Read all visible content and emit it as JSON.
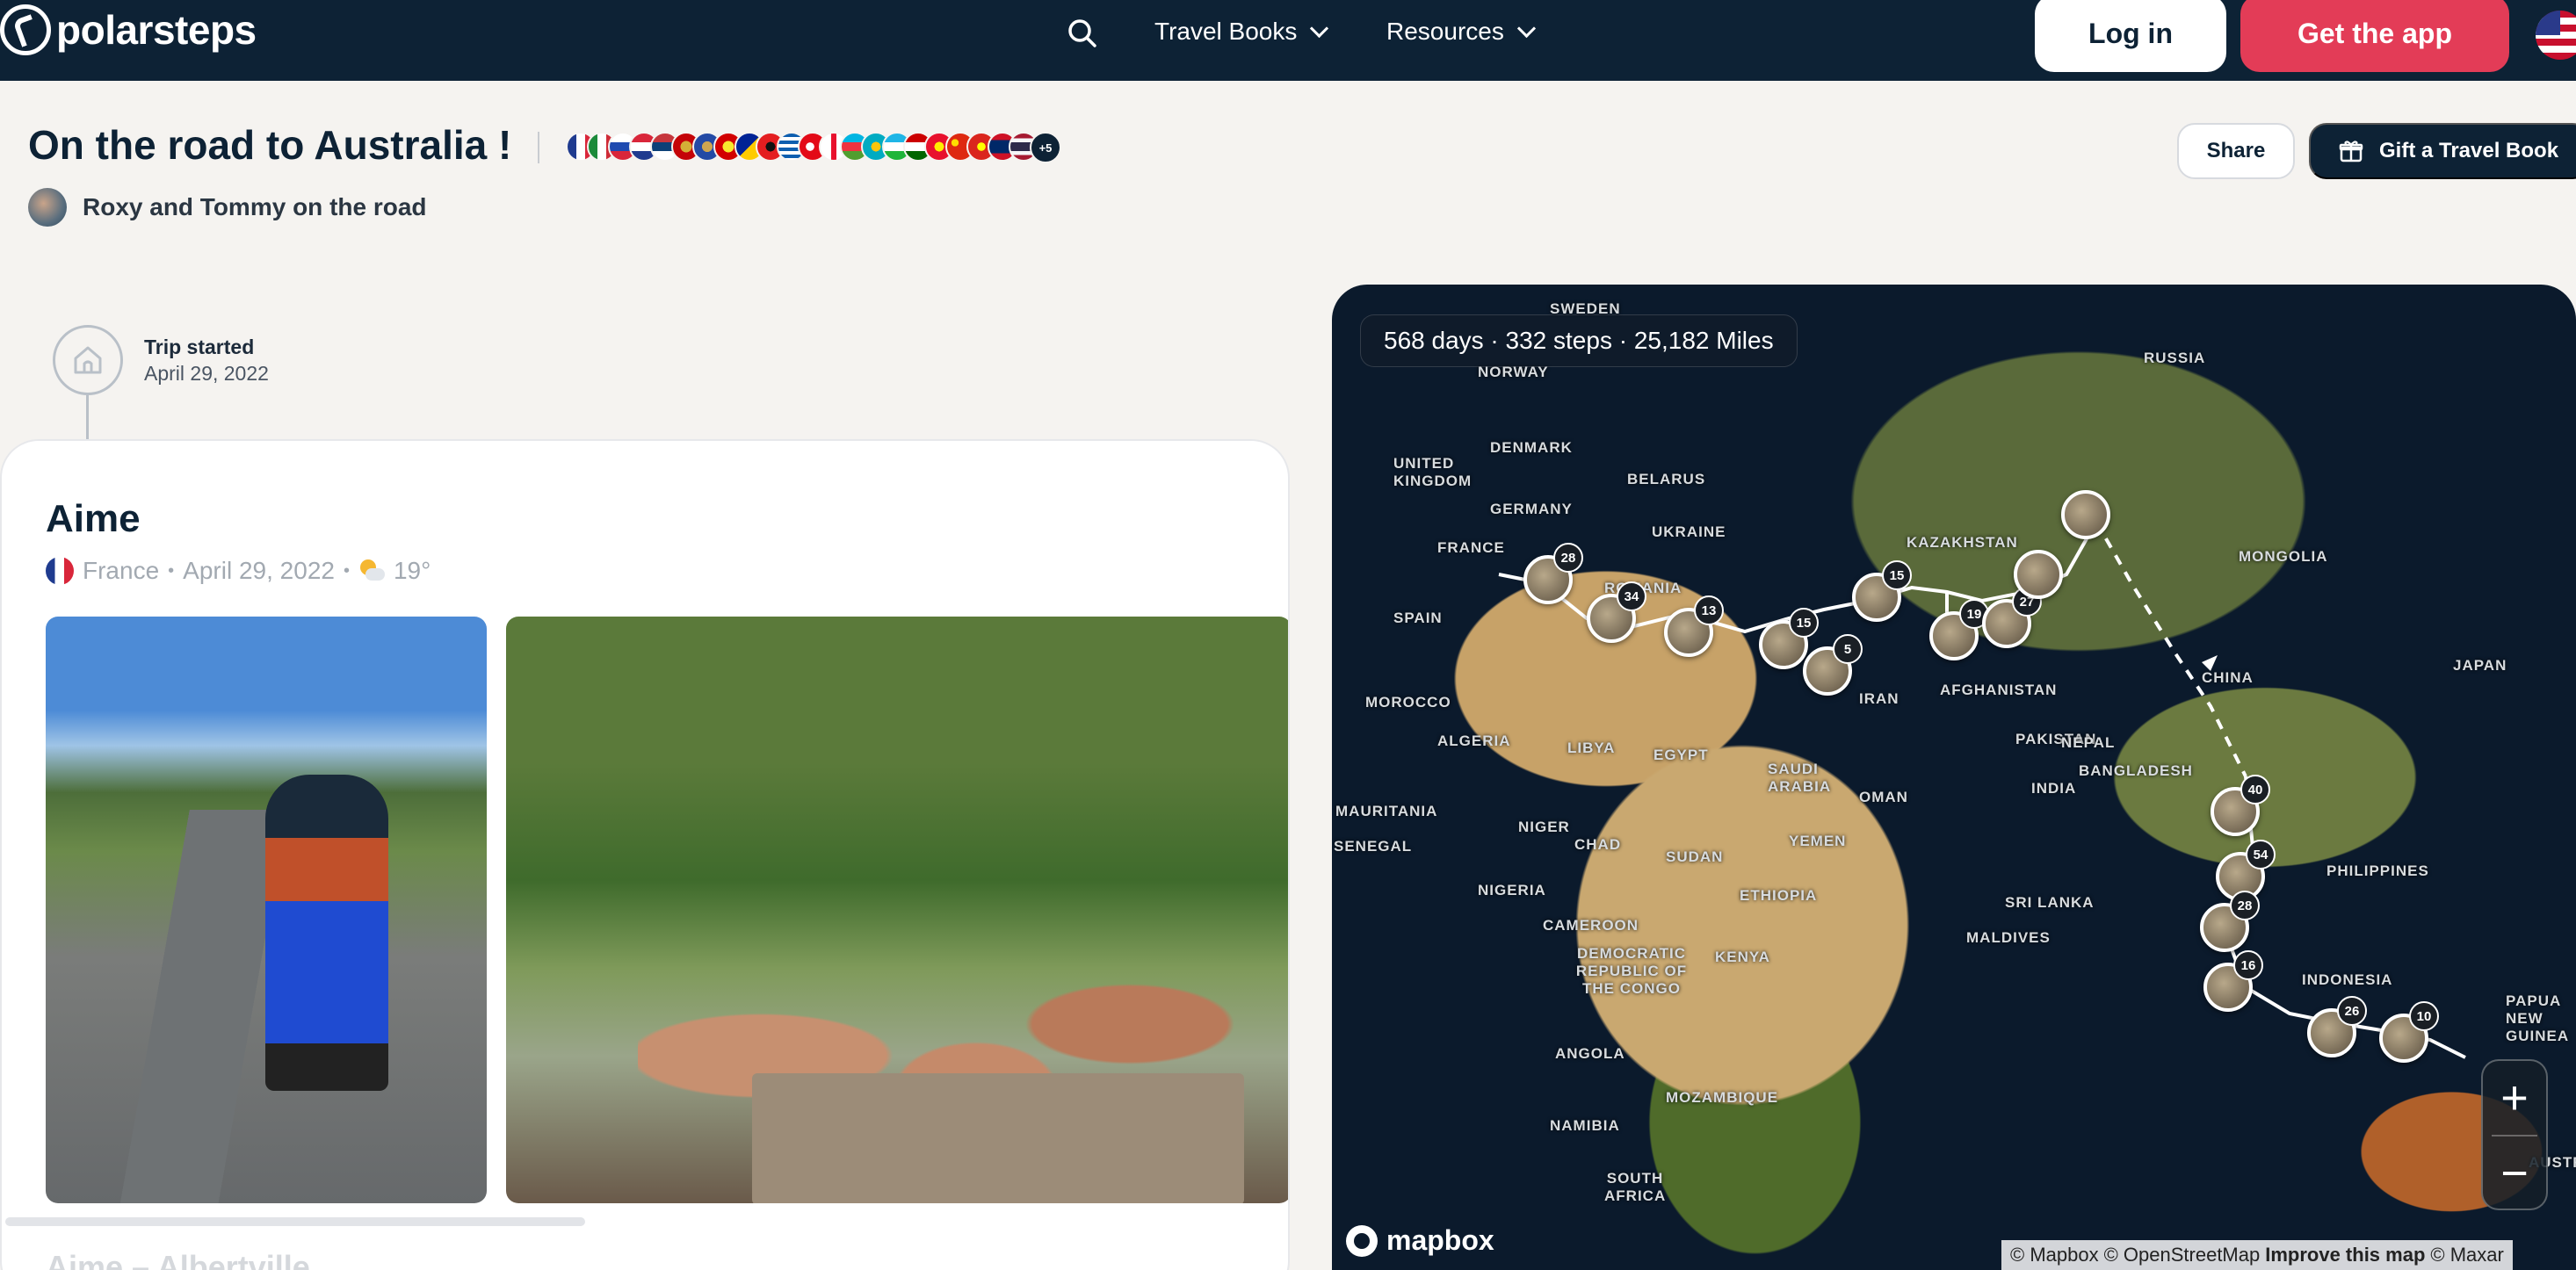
{
  "nav": {
    "logo_text": "polarsteps",
    "search_icon": "search-icon",
    "travel_books_label": "Travel Books",
    "resources_label": "Resources",
    "login_label": "Log in",
    "get_app_label": "Get the app",
    "language_flag": "us-flag-icon",
    "brand_red": "#e33c57",
    "nav_bg": "#0d2235"
  },
  "header": {
    "trip_title": "On the road to Australia !",
    "author_name": "Roxy and Tommy on the road",
    "more_flags_label": "+5",
    "share_label": "Share",
    "gift_label": "Gift a Travel Book"
  },
  "timeline": {
    "start_title": "Trip started",
    "start_date": "April 29, 2022"
  },
  "step": {
    "title": "Aime",
    "country": "France",
    "date": "April 29, 2022",
    "temperature": "19°",
    "next_step_title": "Aime – Albertville"
  },
  "map": {
    "stats": "568 days · 332 steps · 25,182 Miles",
    "labels": [
      "SWEDEN",
      "NORWAY",
      "RUSSIA",
      "DENMARK",
      "UNITED KINGDOM",
      "BELARUS",
      "GERMANY",
      "UKRAINE",
      "FRANCE",
      "KAZAKHSTAN",
      "MONGOLIA",
      "SPAIN",
      "ROMANIA",
      "CHINA",
      "JAPAN",
      "MOROCCO",
      "ALGERIA",
      "LIBYA",
      "EGYPT",
      "SAUDI ARABIA",
      "OMAN",
      "INDIA",
      "BANGLADESH",
      "IRAN",
      "AFGHANISTAN",
      "PAKISTAN",
      "MAURITANIA",
      "NIGER",
      "CHAD",
      "SUDAN",
      "YEMEN",
      "ETHIOPIA",
      "PHILIPPINES",
      "SENEGAL",
      "NIGERIA",
      "CAMEROON",
      "KENYA",
      "SRI LANKA",
      "MALDIVES",
      "INDONESIA",
      "PAPUA NEW GUINEA",
      "DEMOCRATIC REPUBLIC OF THE CONGO",
      "ANGOLA",
      "MOZAMBIQUE",
      "NAMIBIA",
      "SOUTH AFRICA",
      "AUSTRALIA",
      "NEPAL"
    ],
    "pin_counts": [
      "28",
      "34",
      "13",
      "15",
      "5",
      "15",
      "19",
      "27",
      "40",
      "54",
      "28",
      "16",
      "26",
      "10"
    ],
    "zoom_in": "+",
    "zoom_out": "−",
    "mapbox_label": "mapbox",
    "attribution_mapbox": "© Mapbox",
    "attribution_osm": "© OpenStreetMap",
    "attribution_improve": "Improve this map",
    "attribution_maxar": "© Maxar"
  }
}
